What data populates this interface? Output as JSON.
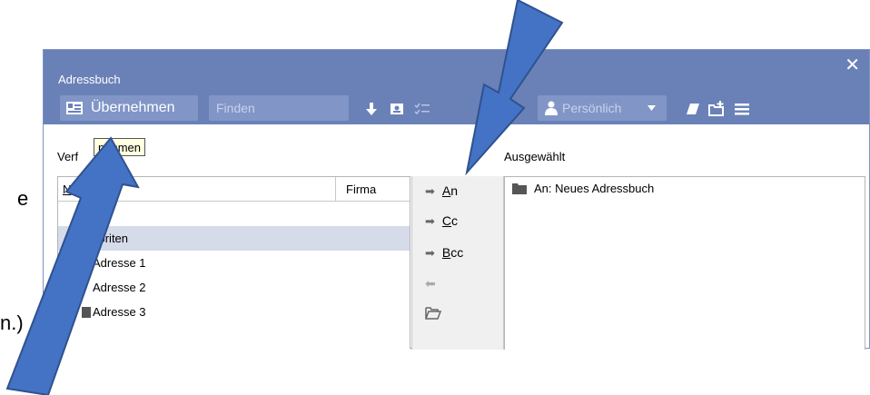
{
  "background_fragments": {
    "frag_e": "e",
    "frag_n": "n.)"
  },
  "window": {
    "title": "Adressbuch",
    "close_glyph": "✕"
  },
  "toolbar": {
    "apply_label": "Übernehmen",
    "find_placeholder": "Finden",
    "book_select_value": "Persönlich",
    "icons": [
      "download-icon",
      "contact-card-icon",
      "checklist-icon",
      "person-icon",
      "eraser-icon",
      "new-folder-icon",
      "menu-icon"
    ]
  },
  "left_pane": {
    "label": "Verf",
    "columns": [
      "N",
      "Firma"
    ],
    "rows": [
      {
        "name": ""
      },
      {
        "name": "voriten",
        "selected": true
      },
      {
        "name": "Adresse 1"
      },
      {
        "name": "Adresse 2"
      },
      {
        "name": "Adresse 3"
      }
    ]
  },
  "tooltip": {
    "text": "nehmen"
  },
  "move_buttons": {
    "to": {
      "key": "A",
      "rest": "n"
    },
    "cc": {
      "key": "C",
      "rest": "c"
    },
    "bcc": {
      "key": "B",
      "rest": "cc"
    }
  },
  "right_pane": {
    "label": "Ausgewählt",
    "items": [
      "An: Neues Adressbuch"
    ]
  },
  "colors": {
    "titlebar": "#6a81b8",
    "control_bg": "#8195c7",
    "selection": "#d5dbe9",
    "arrow_fill": "#4472c4",
    "arrow_stroke": "#2f528f"
  }
}
